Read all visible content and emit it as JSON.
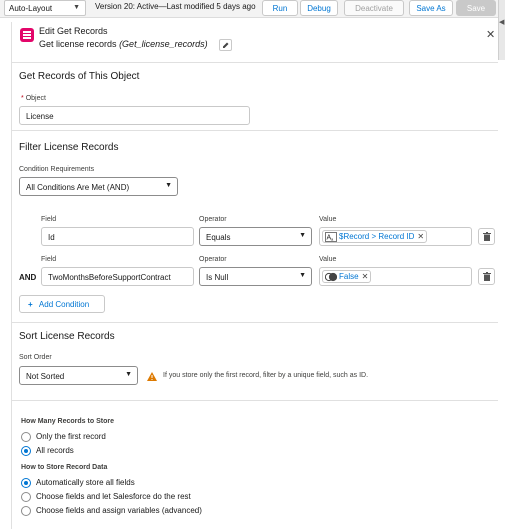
{
  "toolbar": {
    "layout_select": "Auto-Layout",
    "version_text": "Version 20: Active—Last modified 5 days ago",
    "run_label": "Run",
    "debug_label": "Debug",
    "deactivate_label": "Deactivate",
    "save_as_label": "Save As",
    "save_label": "Save"
  },
  "header": {
    "title": "Edit Get Records",
    "subtitle_label": "Get license records",
    "subtitle_api": "(Get_license_records)"
  },
  "object_section": {
    "title": "Get Records of This Object",
    "object_label": "Object",
    "object_value": "License"
  },
  "filter_section": {
    "title": "Filter License Records",
    "condition_label": "Condition Requirements",
    "condition_value": "All Conditions Are Met (AND)",
    "field_label": "Field",
    "operator_label": "Operator",
    "value_label": "Value",
    "and_label": "AND",
    "conditions": [
      {
        "field": "Id",
        "operator": "Equals",
        "value": "$Record > Record ID"
      },
      {
        "field": "TwoMonthsBeforeSupportContract",
        "operator": "Is Null",
        "value": "False"
      }
    ],
    "add_condition_label": "Add Condition"
  },
  "sort_section": {
    "title": "Sort License Records",
    "sort_order_label": "Sort Order",
    "sort_order_value": "Not Sorted",
    "warning_text": "If you store only the first record, filter by a unique field, such as ID."
  },
  "store_section": {
    "how_many_label": "How Many Records to Store",
    "how_many_options": [
      "Only the first record",
      "All records"
    ],
    "how_many_selected": 1,
    "how_store_label": "How to Store Record Data",
    "how_store_options": [
      "Automatically store all fields",
      "Choose fields and let Salesforce do the rest",
      "Choose fields and assign variables (advanced)"
    ],
    "how_store_selected": 0
  },
  "colors": {
    "brand_blue": "#0176d3",
    "element_icon": "#e3066a",
    "warning": "#dd7a01"
  }
}
